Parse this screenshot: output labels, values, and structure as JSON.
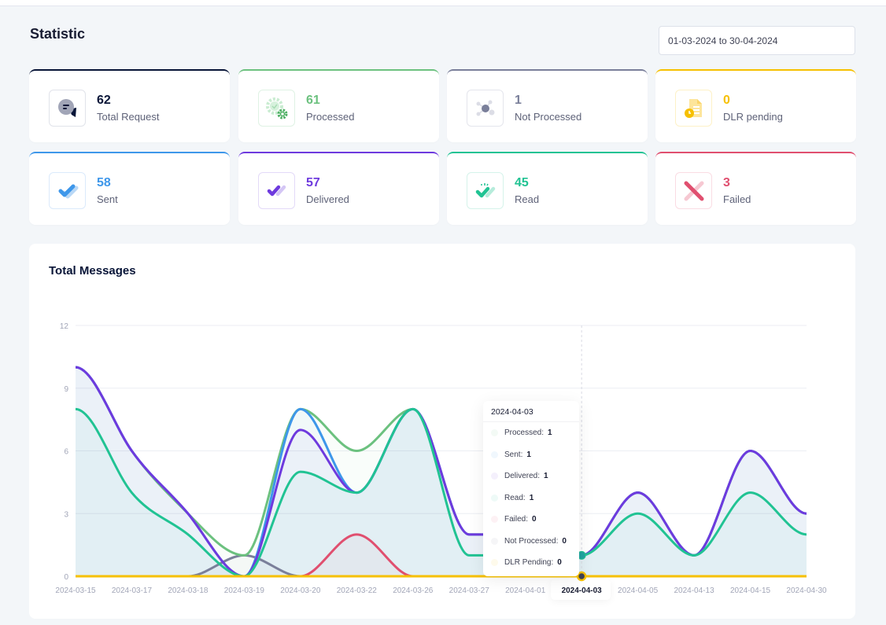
{
  "page": {
    "title": "Statistic",
    "date_range": "01-03-2024 to 30-04-2024"
  },
  "cards": [
    {
      "id": "total-request",
      "value": "62",
      "label": "Total Request",
      "color": "#071437",
      "icon": "chat-bubbles-icon"
    },
    {
      "id": "processed",
      "value": "61",
      "label": "Processed",
      "color": "#6cc17f",
      "icon": "gears-icon"
    },
    {
      "id": "not-processed",
      "value": "1",
      "label": "Not Processed",
      "color": "#7a7f9a",
      "icon": "nodes-icon"
    },
    {
      "id": "dlr-pending",
      "value": "0",
      "label": "DLR pending",
      "color": "#f6c000",
      "icon": "document-clock-icon"
    },
    {
      "id": "sent",
      "value": "58",
      "label": "Sent",
      "color": "#3e97ea",
      "icon": "check-icon"
    },
    {
      "id": "delivered",
      "value": "57",
      "label": "Delivered",
      "color": "#6e3ade",
      "icon": "double-check-icon"
    },
    {
      "id": "read",
      "value": "45",
      "label": "Read",
      "color": "#21c393",
      "icon": "read-check-icon"
    },
    {
      "id": "failed",
      "value": "3",
      "label": "Failed",
      "color": "#e04f6f",
      "icon": "cross-icon"
    }
  ],
  "chart_data": {
    "type": "area",
    "title": "Total Messages",
    "xlabel": "",
    "ylabel": "",
    "ylim": [
      0,
      12
    ],
    "yticks": [
      "0",
      "3",
      "6",
      "9",
      "12"
    ],
    "grid": true,
    "categories": [
      "2024-03-15",
      "2024-03-17",
      "2024-03-18",
      "2024-03-19",
      "2024-03-20",
      "2024-03-22",
      "2024-03-26",
      "2024-03-27",
      "2024-04-01",
      "2024-04-03",
      "2024-04-05",
      "2024-04-13",
      "2024-04-15",
      "2024-04-30"
    ],
    "series": [
      {
        "name": "Processed",
        "color": "#6cc17f",
        "values": [
          10,
          6,
          3,
          1,
          8,
          6,
          8,
          2,
          2,
          1,
          4,
          1,
          6,
          3
        ]
      },
      {
        "name": "Sent",
        "color": "#3e97ea",
        "values": [
          10,
          6,
          3,
          0,
          8,
          4,
          8,
          2,
          2,
          1,
          4,
          1,
          6,
          3
        ]
      },
      {
        "name": "Delivered",
        "color": "#6e3ade",
        "values": [
          10,
          6,
          3,
          0,
          7,
          4,
          8,
          2,
          2,
          1,
          4,
          1,
          6,
          3
        ]
      },
      {
        "name": "Read",
        "color": "#21c393",
        "values": [
          8,
          4,
          2,
          0,
          5,
          4,
          8,
          1,
          1,
          1,
          3,
          1,
          4,
          2
        ]
      },
      {
        "name": "Failed",
        "color": "#e04f6f",
        "values": [
          0,
          0,
          0,
          0,
          0,
          2,
          0,
          0,
          0,
          0,
          0,
          0,
          0,
          0
        ]
      },
      {
        "name": "Not Processed",
        "color": "#7a7f9a",
        "values": [
          0,
          0,
          0,
          1,
          0,
          0,
          0,
          0,
          0,
          0,
          0,
          0,
          0,
          0
        ]
      },
      {
        "name": "DLR Pending",
        "color": "#f6c000",
        "values": [
          0,
          0,
          0,
          0,
          0,
          0,
          0,
          0,
          0,
          0,
          0,
          0,
          0,
          0
        ]
      }
    ],
    "active_index": 9,
    "tooltip": {
      "title": "2024-04-03",
      "rows": [
        {
          "label": "Processed:",
          "value": "1",
          "color": "#6cc17f"
        },
        {
          "label": "Sent:",
          "value": "1",
          "color": "#3e97ea"
        },
        {
          "label": "Delivered:",
          "value": "1",
          "color": "#6e3ade"
        },
        {
          "label": "Read:",
          "value": "1",
          "color": "#21c393"
        },
        {
          "label": "Failed:",
          "value": "0",
          "color": "#e04f6f"
        },
        {
          "label": "Not Processed:",
          "value": "0",
          "color": "#7a7f9a"
        },
        {
          "label": "DLR Pending:",
          "value": "0",
          "color": "#f6c000"
        }
      ]
    }
  }
}
